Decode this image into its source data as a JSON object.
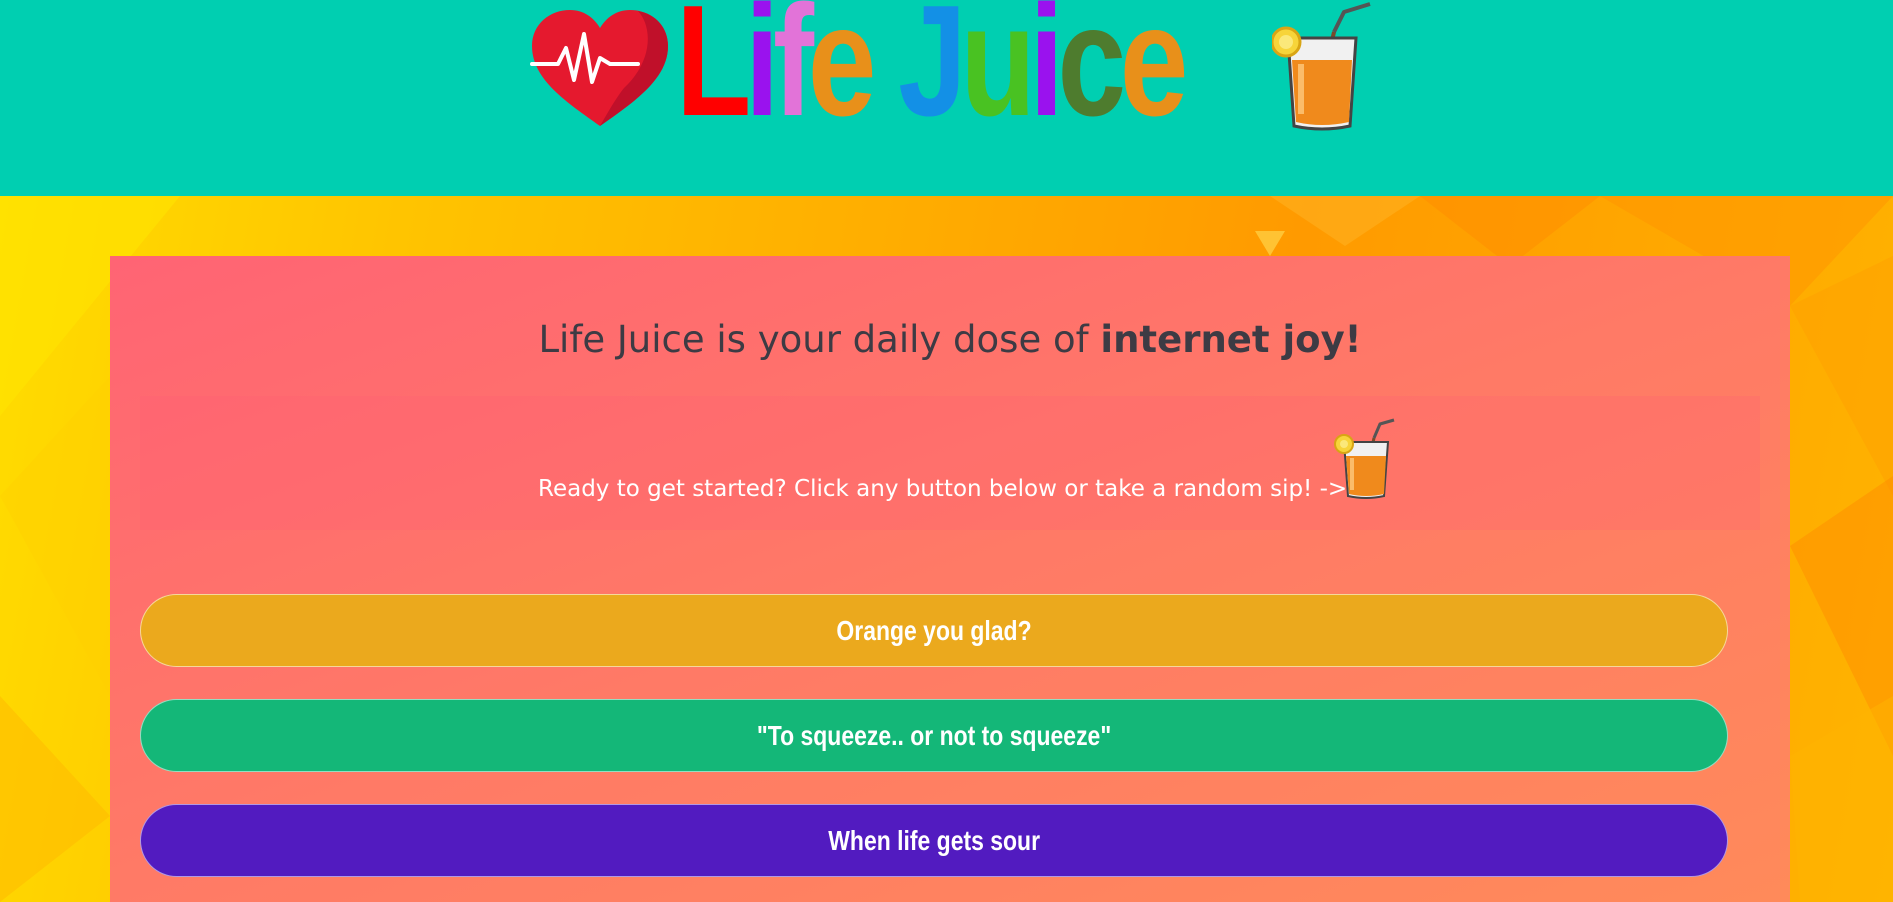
{
  "header": {
    "logo": {
      "letters": [
        {
          "char": "L",
          "color": "#ff0000"
        },
        {
          "char": "i",
          "color": "#9a12ee"
        },
        {
          "char": "f",
          "color": "#e273d8"
        },
        {
          "char": "e",
          "color": "#e8901a"
        },
        {
          "char": " ",
          "color": "#ffffff"
        },
        {
          "char": "J",
          "color": "#1390e6"
        },
        {
          "char": "u",
          "color": "#49c222"
        },
        {
          "char": "i",
          "color": "#9a12ee"
        },
        {
          "char": "c",
          "color": "#4e7c2e"
        },
        {
          "char": "e",
          "color": "#e8901a"
        }
      ],
      "heart_icon": "heartbeat-heart-icon",
      "glass_icon": "orange-juice-glass-icon"
    },
    "background_color": "#00cfb1"
  },
  "main": {
    "tagline_prefix": "Life Juice is your daily dose of ",
    "tagline_bold": "internet joy!",
    "cta_text": "Ready to get started? Click any button below or take a random sip! ->",
    "random_sip_icon": "orange-juice-glass-icon",
    "buttons": [
      {
        "label": "Orange you glad?",
        "color": "#eba91d"
      },
      {
        "label": "\"To squeeze.. or not to squeeze\"",
        "color": "#14b778"
      },
      {
        "label": "When life gets sour",
        "color": "#521bc0"
      }
    ]
  }
}
